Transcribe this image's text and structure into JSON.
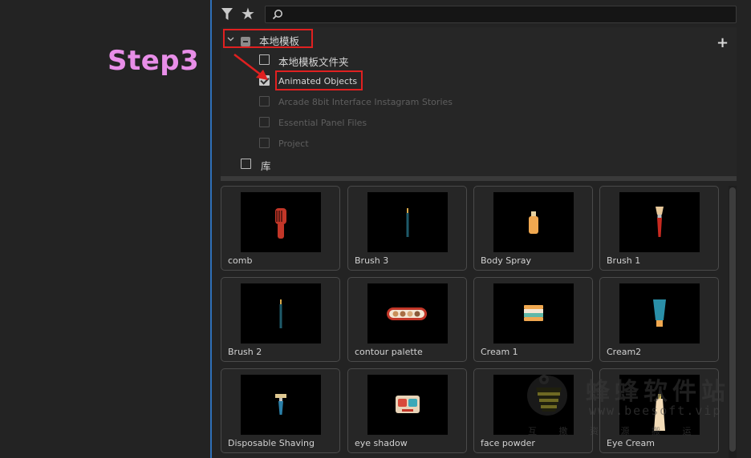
{
  "annotation": {
    "step_text": "Step3"
  },
  "toolbar": {
    "search_placeholder": "",
    "search_value": ""
  },
  "tree": {
    "root_label": "本地模板",
    "children": [
      {
        "label": "本地模板文件夹",
        "checked": false,
        "enabled": true
      },
      {
        "label": "Animated Objects",
        "checked": true,
        "enabled": true
      },
      {
        "label": "Arcade 8bit Interface Instagram Stories",
        "checked": false,
        "enabled": false
      },
      {
        "label": "Essential Panel Files",
        "checked": false,
        "enabled": false
      },
      {
        "label": "Project",
        "checked": false,
        "enabled": false
      }
    ],
    "library_label": "库"
  },
  "templates": [
    {
      "label": "comb",
      "icon": "comb"
    },
    {
      "label": "Brush 3",
      "icon": "thin-brush"
    },
    {
      "label": "Body Spray",
      "icon": "spray-bottle"
    },
    {
      "label": "Brush 1",
      "icon": "makeup-brush"
    },
    {
      "label": "Brush 2",
      "icon": "thin-brush"
    },
    {
      "label": "contour palette",
      "icon": "palette"
    },
    {
      "label": "Cream 1",
      "icon": "cream-jar"
    },
    {
      "label": "Cream2",
      "icon": "cream-tube"
    },
    {
      "label": "Disposable Shaving",
      "icon": "razor"
    },
    {
      "label": "eye shadow",
      "icon": "eyeshadow"
    },
    {
      "label": "face powder",
      "icon": "powder"
    },
    {
      "label": "Eye Cream",
      "icon": "eye-cream"
    }
  ],
  "watermark": {
    "title": "蜂蜂软件站",
    "url": "www.beesoft.vip",
    "subtitle": "互 撒 资 源 搬 运"
  },
  "colors": {
    "highlight": "#e02020",
    "step": "#e88ee8",
    "accent_line": "#2e6fb8"
  }
}
